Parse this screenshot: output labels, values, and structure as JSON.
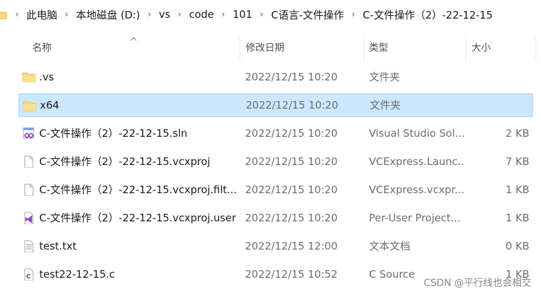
{
  "breadcrumb": {
    "items": [
      "此电脑",
      "本地磁盘 (D:)",
      "vs",
      "code",
      "101",
      "C语言-文件操作",
      "C-文件操作（2）-22-12-15"
    ],
    "separator": "›"
  },
  "columns": {
    "name": "名称",
    "date": "修改日期",
    "type": "类型",
    "size": "大小"
  },
  "files": [
    {
      "name": ".vs",
      "date": "2022/12/15 10:20",
      "type": "文件夹",
      "size": "",
      "icon": "folder-icon",
      "selected": false
    },
    {
      "name": "x64",
      "date": "2022/12/15 10:20",
      "type": "文件夹",
      "size": "",
      "icon": "folder-icon",
      "selected": true
    },
    {
      "name": "C-文件操作（2）-22-12-15.sln",
      "date": "2022/12/15 10:20",
      "type": "Visual Studio Sol...",
      "size": "2 KB",
      "icon": "vs-solution-icon",
      "selected": false
    },
    {
      "name": "C-文件操作（2）-22-12-15.vcxproj",
      "date": "2022/12/15 10:20",
      "type": "VCExpress.Launc...",
      "size": "7 KB",
      "icon": "blank-file-icon",
      "selected": false
    },
    {
      "name": "C-文件操作（2）-22-12-15.vcxproj.filt...",
      "date": "2022/12/15 10:20",
      "type": "VCExpress.vcxpr...",
      "size": "1 KB",
      "icon": "blank-file-icon",
      "selected": false
    },
    {
      "name": "C-文件操作（2）-22-12-15.vcxproj.user",
      "date": "2022/12/15 10:20",
      "type": "Per-User Project...",
      "size": "1 KB",
      "icon": "vs-project-user-icon",
      "selected": false
    },
    {
      "name": "test.txt",
      "date": "2022/12/15 12:00",
      "type": "文本文档",
      "size": "0 KB",
      "icon": "text-file-icon",
      "selected": false
    },
    {
      "name": "test22-12-15.c",
      "date": "2022/12/15 10:52",
      "type": "C Source",
      "size": "1 KB",
      "icon": "c-source-icon",
      "selected": false
    }
  ],
  "watermark": "CSDN @平行线也会相交",
  "colors": {
    "selection_bg": "#cce8ff",
    "selection_border": "#99d1ff",
    "folder": "#f8d775"
  }
}
